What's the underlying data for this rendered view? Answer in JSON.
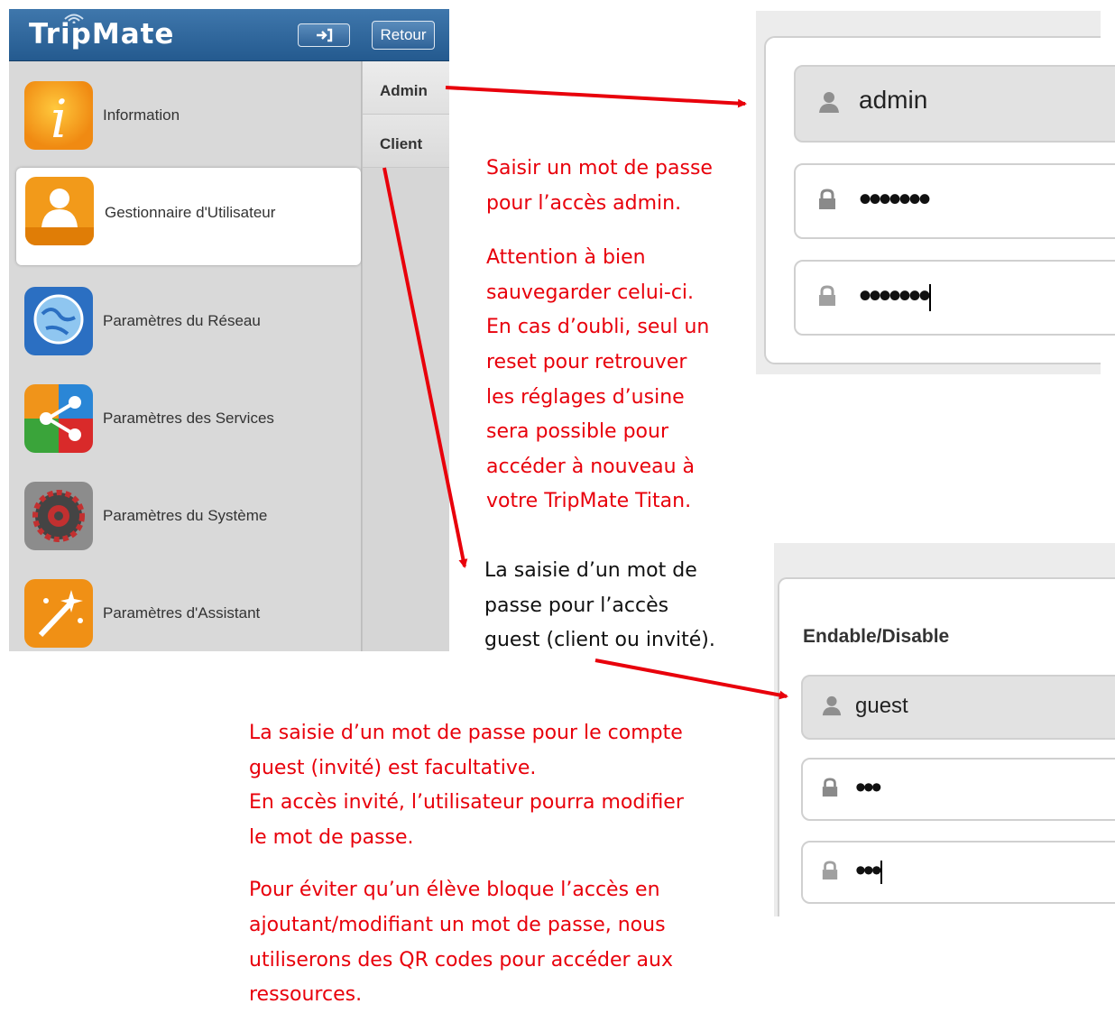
{
  "app": {
    "title": "TripMate",
    "back_label": "Retour",
    "menu": [
      {
        "label": "Information",
        "icon": "information-icon"
      },
      {
        "label": "Gestionnaire d'Utilisateur",
        "icon": "user-manager-icon",
        "active": true
      },
      {
        "label": "Paramètres du Réseau",
        "icon": "network-globe-icon"
      },
      {
        "label": "Paramètres des Services",
        "icon": "share-services-icon"
      },
      {
        "label": "Paramètres du Système",
        "icon": "system-gear-icon"
      },
      {
        "label": "Paramètres d'Assistant",
        "icon": "wizard-wand-icon"
      }
    ],
    "submenu": [
      "Admin",
      "Client"
    ]
  },
  "admin_form": {
    "username": "admin",
    "password_dots": "•••••••",
    "confirm_dots": "•••••••"
  },
  "guest_form": {
    "toggle_label": "Endable/Disable",
    "username": "guest",
    "password_dots": "•••",
    "confirm_dots": "•••"
  },
  "notes": {
    "admin_lines": [
      "Saisir un mot de passe",
      "pour l’accès admin.",
      "",
      "Attention à bien",
      "sauvegarder celui-ci.",
      "En cas d’oubli, seul un",
      "reset pour retrouver",
      "les réglages d’usine",
      "sera possible pour",
      "accéder à nouveau à",
      "votre TripMate Titan."
    ],
    "guest_lines": [
      "La saisie d’un mot de",
      "passe pour l’accès",
      "guest (client ou invité)."
    ],
    "bottom_lines": [
      "La saisie d’un mot de passe pour le compte",
      "guest (invité) est facultative.",
      "En accès invité, l’utilisateur pourra modifier",
      "le mot de passe.",
      "",
      "Pour éviter qu’un élève bloque l’accès en",
      "ajoutant/modifiant un mot de passe, nous",
      "utiliserons des QR codes pour accéder aux",
      "ressources."
    ]
  },
  "colors": {
    "header_blue": "#2f6398",
    "annotation_red": "#e8000b",
    "panel_gray": "#d9d9d9"
  }
}
